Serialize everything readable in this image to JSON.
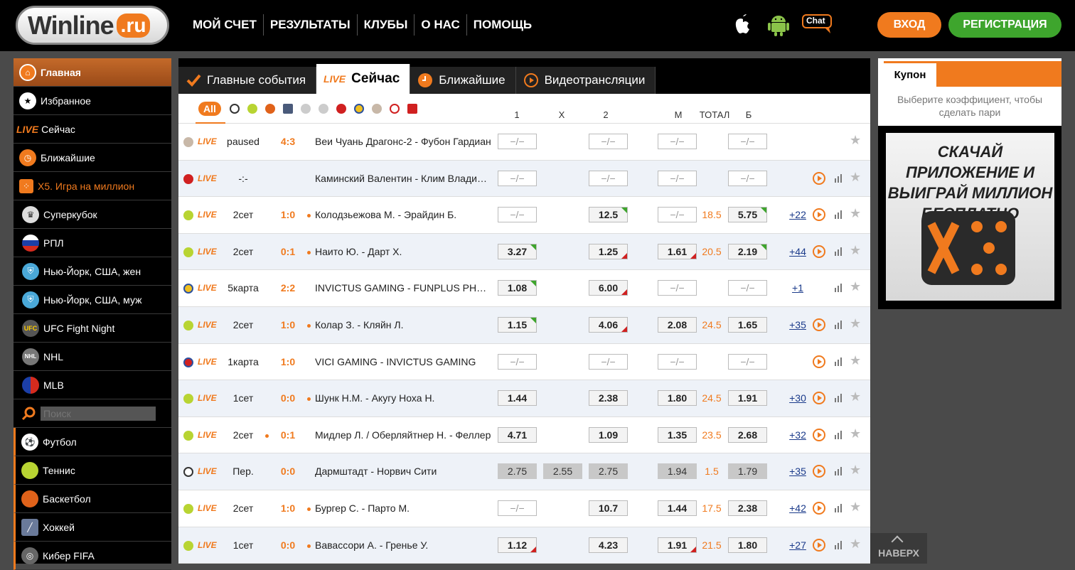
{
  "header": {
    "logo": "Winline",
    "logo_suffix": ".ru",
    "nav": [
      "МОЙ СЧЕТ",
      "РЕЗУЛЬТАТЫ",
      "КЛУБЫ",
      "О НАС",
      "ПОМОЩЬ"
    ],
    "chat_label": "Chat",
    "login_label": "ВХОД",
    "register_label": "РЕГИСТРАЦИЯ"
  },
  "sidebar": {
    "main_items": [
      {
        "label": "Главная",
        "icon": "home-icon",
        "active": true
      },
      {
        "label": "Избранное",
        "icon": "star-icon"
      },
      {
        "label": "Сейчас",
        "icon": "live-icon",
        "prefix": "LIVE"
      },
      {
        "label": "Ближайшие",
        "icon": "clock-icon"
      },
      {
        "label": "X5. Игра на миллион",
        "icon": "dice-icon"
      },
      {
        "label": "Суперкубок",
        "icon": "trophy-icon"
      },
      {
        "label": "РПЛ",
        "icon": "russia-flag-icon"
      },
      {
        "label": "Нью-Йорк, США, жен",
        "icon": "shield-icon"
      },
      {
        "label": "Нью-Йорк, США, муж",
        "icon": "shield-icon"
      },
      {
        "label": "UFC Fight Night",
        "icon": "ufc-icon"
      },
      {
        "label": "NHL",
        "icon": "nhl-icon"
      },
      {
        "label": "MLB",
        "icon": "mlb-icon"
      }
    ],
    "search_placeholder": "Поиск",
    "sports": [
      {
        "label": "Футбол",
        "icon": "football-icon"
      },
      {
        "label": "Теннис",
        "icon": "tennis-icon"
      },
      {
        "label": "Баскетбол",
        "icon": "basketball-icon"
      },
      {
        "label": "Хоккей",
        "icon": "hockey-icon"
      },
      {
        "label": "Кибер FIFA",
        "icon": "cyber-fifa-icon"
      }
    ]
  },
  "tabs": [
    {
      "label": "Главные события",
      "icon": "check-icon"
    },
    {
      "label": "Сейчас",
      "prefix": "LIVE",
      "active": true
    },
    {
      "label": "Ближайшие",
      "icon": "clock-icon"
    },
    {
      "label": "Видеотрансляции",
      "icon": "play-icon"
    }
  ],
  "filter": {
    "all_label": "All"
  },
  "columns": {
    "c1": "1",
    "cx": "X",
    "c2": "2",
    "m": "М",
    "total": "ТОТАЛ",
    "b": "Б"
  },
  "live_label": "LIVE",
  "events": [
    {
      "sport": "volleyball",
      "period": "paused",
      "score": "4:3",
      "dot": false,
      "name": "Веи Чуань Драгонс-2 - Фубон Гардиан",
      "o1": "−/−",
      "o2": "−/−",
      "m": "−/−",
      "total": "",
      "b": "−/−",
      "more": "",
      "video": false,
      "stats": false
    },
    {
      "sport": "table-tennis",
      "period": "-:-",
      "score": "",
      "dot": false,
      "name": "Каминский Валентин - Клим Владимир",
      "o1": "−/−",
      "o2": "−/−",
      "m": "−/−",
      "total": "",
      "b": "−/−",
      "more": "",
      "video": true,
      "stats": true
    },
    {
      "sport": "tennis",
      "period": "2сет",
      "score": "1:0",
      "dot": true,
      "name": "Колодзьежова М. - Эрайдин Б.",
      "o1": "−/−",
      "o2": "12.5",
      "o2t": "up",
      "m": "−/−",
      "mgrey": true,
      "total": "18.5",
      "b": "5.75",
      "bt": "up",
      "more": "+22",
      "video": true,
      "stats": true
    },
    {
      "sport": "tennis",
      "period": "2сет",
      "score": "0:1",
      "dot": true,
      "name": "Наито Ю. - Дарт Х.",
      "o1": "3.27",
      "o1t": "up",
      "o2": "1.25",
      "o2t": "dn",
      "m": "1.61",
      "mt": "dn",
      "total": "20.5",
      "b": "2.19",
      "bt": "up",
      "more": "+44",
      "video": true,
      "stats": true
    },
    {
      "sport": "dota",
      "period": "5карта",
      "score": "2:2",
      "dot": false,
      "name": "INVICTUS GAMING - FUNPLUS PHOENIX",
      "o1": "1.08",
      "o1t": "up",
      "o2": "6.00",
      "o2t": "dn",
      "m": "−/−",
      "total": "",
      "b": "−/−",
      "more": "+1",
      "video": false,
      "stats": true
    },
    {
      "sport": "tennis",
      "period": "2сет",
      "score": "1:0",
      "dot": true,
      "name": "Колар З. - Кляйн Л.",
      "o1": "1.15",
      "o1t": "up",
      "o2": "4.06",
      "o2t": "dn",
      "m": "2.08",
      "total": "24.5",
      "b": "1.65",
      "more": "+35",
      "video": true,
      "stats": true
    },
    {
      "sport": "esport",
      "period": "1карта",
      "score": "1:0",
      "dot": false,
      "name": "VICI GAMING - INVICTUS GAMING",
      "o1": "−/−",
      "o2": "−/−",
      "m": "−/−",
      "total": "",
      "b": "−/−",
      "more": "",
      "video": true,
      "stats": true
    },
    {
      "sport": "tennis",
      "period": "1сет",
      "score": "0:0",
      "dot": true,
      "name": "Шунк Н.М. - Акугу Ноха Н.",
      "o1": "1.44",
      "o2": "2.38",
      "m": "1.80",
      "total": "24.5",
      "b": "1.91",
      "more": "+30",
      "video": true,
      "stats": true
    },
    {
      "sport": "tennis",
      "period": "2сет",
      "score": "0:1",
      "dot": false,
      "dotperiod": true,
      "name": "Мидлер Л. / Оберляйтнер Н. - Феллер",
      "o1": "4.71",
      "o2": "1.09",
      "m": "1.35",
      "total": "23.5",
      "b": "2.68",
      "more": "+32",
      "video": true,
      "stats": true
    },
    {
      "sport": "football",
      "period": "Пер.",
      "score": "0:0",
      "dot": false,
      "name": "Дармштадт - Норвич Сити",
      "o1": "2.75",
      "ox": "2.55",
      "o2": "2.75",
      "m": "1.94",
      "total": "1.5",
      "b": "1.79",
      "grey": true,
      "more": "+35",
      "video": true,
      "stats": true
    },
    {
      "sport": "tennis",
      "period": "2сет",
      "score": "1:0",
      "dot": true,
      "name": "Бургер С. - Парто М.",
      "o1": "−/−",
      "o2": "10.7",
      "m": "1.44",
      "total": "17.5",
      "b": "2.38",
      "more": "+42",
      "video": true,
      "stats": true
    },
    {
      "sport": "tennis",
      "period": "1сет",
      "score": "0:0",
      "dot": true,
      "name": "Вавассори А. - Гренье У.",
      "o1": "1.12",
      "o1t": "dn",
      "o2": "4.23",
      "m": "1.91",
      "mt": "dn",
      "total": "21.5",
      "b": "1.80",
      "more": "+27",
      "video": true,
      "stats": true
    }
  ],
  "coupon": {
    "title": "Купон",
    "hint": "Выберите коэффициент, чтобы сделать пари"
  },
  "banner": {
    "text": "СКАЧАЙ ПРИЛОЖЕНИЕ И ВЫИГРАЙ МИЛЛИОН БЕСПЛАТНО"
  },
  "scroll_top_label": "НАВЕРХ",
  "colors": {
    "accent": "#f07a1e",
    "green": "#3ea52d",
    "link": "#1a3a8a"
  }
}
